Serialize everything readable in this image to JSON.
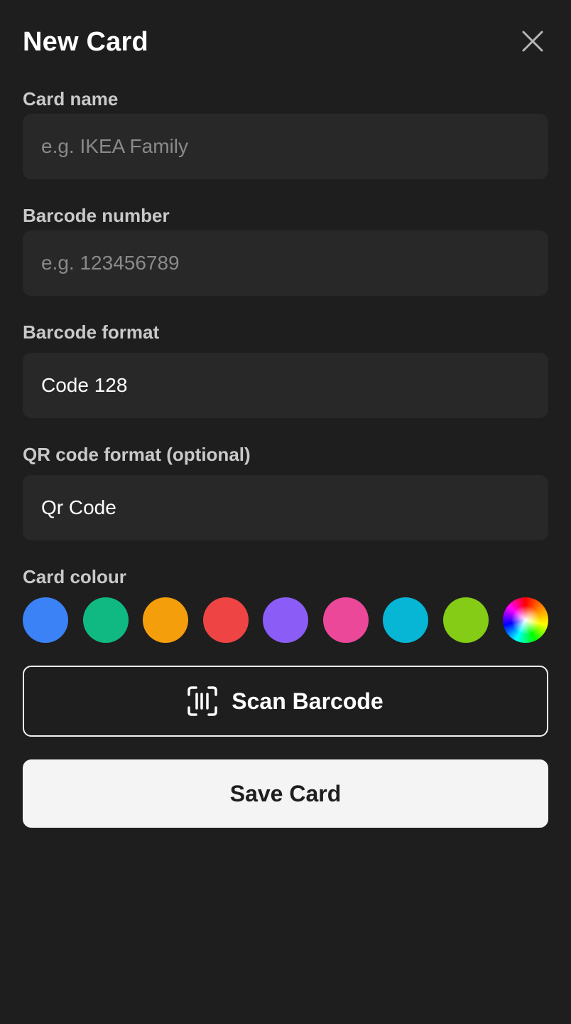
{
  "header": {
    "title": "New Card",
    "close_icon": "close-icon"
  },
  "form": {
    "card_name": {
      "label": "Card name",
      "placeholder": "e.g. IKEA Family",
      "value": ""
    },
    "barcode_number": {
      "label": "Barcode number",
      "placeholder": "e.g. 123456789",
      "value": ""
    },
    "barcode_format": {
      "label": "Barcode format",
      "value": "Code 128"
    },
    "qr_format": {
      "label": "QR code format (optional)",
      "value": "Qr Code"
    },
    "colour": {
      "label": "Card colour",
      "swatches": [
        "#3b82f6",
        "#10b981",
        "#f59e0b",
        "#ef4444",
        "#8b5cf6",
        "#ec4899",
        "#06b6d4",
        "#84cc16",
        "rainbow"
      ]
    }
  },
  "actions": {
    "scan_label": "Scan Barcode",
    "scan_icon": "barcode-scan-icon",
    "save_label": "Save Card"
  }
}
